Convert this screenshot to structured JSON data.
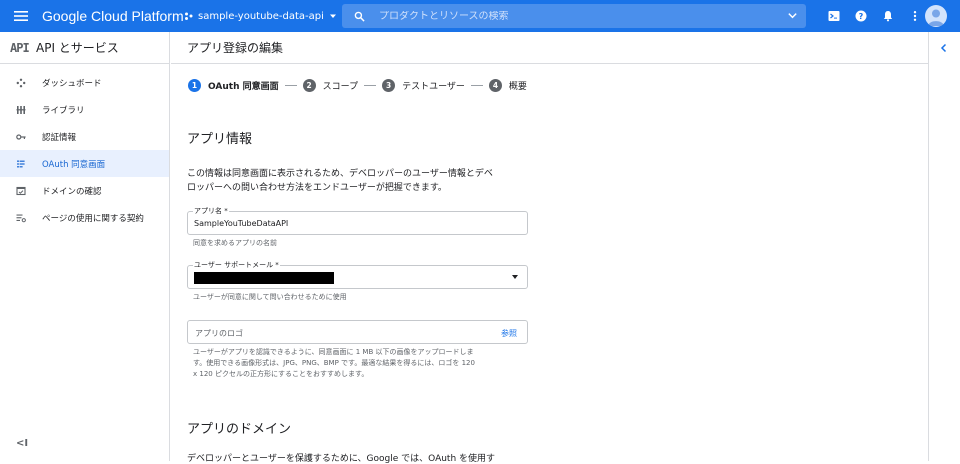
{
  "topbar": {
    "brand": "Google Cloud Platform",
    "project": "sample-youtube-data-api",
    "search_placeholder": "プロダクトとリソースの検索"
  },
  "sidebar": {
    "title": "API とサービス",
    "logo": "API",
    "items": [
      {
        "label": "ダッシュボード",
        "icon": "dashboard-icon",
        "active": false
      },
      {
        "label": "ライブラリ",
        "icon": "library-icon",
        "active": false
      },
      {
        "label": "認証情報",
        "icon": "key-icon",
        "active": false
      },
      {
        "label": "OAuth 同意画面",
        "icon": "consent-icon",
        "active": true
      },
      {
        "label": "ドメインの確認",
        "icon": "domain-verification-icon",
        "active": false
      },
      {
        "label": "ページの使用に関する契約",
        "icon": "settings-list-icon",
        "active": false
      }
    ],
    "collapse_label": "<I"
  },
  "page": {
    "title": "アプリ登録の編集",
    "steps": [
      {
        "num": "1",
        "label": "OAuth 同意画面",
        "active": true
      },
      {
        "num": "2",
        "label": "スコープ",
        "active": false
      },
      {
        "num": "3",
        "label": "テストユーザー",
        "active": false
      },
      {
        "num": "4",
        "label": "概要",
        "active": false
      }
    ]
  },
  "app_info": {
    "title": "アプリ情報",
    "desc_line1": "この情報は同意画面に表示されるため、デベロッパーのユーザー情報とデベ",
    "desc_line2": "ロッパーへの問い合わせ方法をエンドユーザーが把握できます。",
    "app_name_label": "アプリ名 *",
    "app_name_value": "SampleYouTubeDataAPI",
    "app_name_hint": "同意を求めるアプリの名前",
    "support_email_label": "ユーザー サポートメール *",
    "support_email_hint": "ユーザーが同意に関して問い合わせるために使用",
    "logo_placeholder": "アプリのロゴ",
    "logo_browse": "参照",
    "logo_hint_line1": "ユーザーがアプリを認識できるように、同意画面に 1 MB 以下の画像をアップロードしま",
    "logo_hint_line2": "す。使用できる画像形式は、JPG、PNG、BMP です。最適な結果を得るには、ロゴを 120",
    "logo_hint_line3": "x 120 ピクセルの正方形にすることをおすすめします。"
  },
  "app_domain": {
    "title": "アプリのドメイン",
    "desc_partial": "デベロッパーとユーザーを保護するために、Google では、OAuth を使用す"
  },
  "colors": {
    "topbar": "#1a73e8",
    "active_bg": "#e8f0fe",
    "active_text": "#1967d2"
  }
}
